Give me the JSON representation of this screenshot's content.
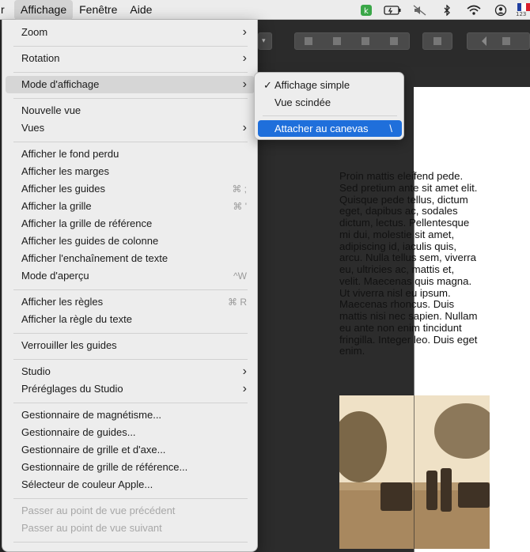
{
  "menubar": {
    "partial": "r",
    "items": [
      "Affichage",
      "Fenêtre",
      "Aide"
    ],
    "active": "Affichage",
    "status_icons": [
      "app-k-icon",
      "battery-plug-icon",
      "mute-icon",
      "bluetooth-icon",
      "wifi-icon",
      "user-icon"
    ],
    "keyboard_layout": "123"
  },
  "menu": {
    "items": [
      {
        "label": "Zoom",
        "submenu": true
      },
      {
        "label": "Rotation",
        "submenu": true
      },
      {
        "label": "Mode d'affichage",
        "submenu": true,
        "highlighted": true
      },
      {
        "label": "Nouvelle vue"
      },
      {
        "label": "Vues",
        "submenu": true
      },
      {
        "label": "Afficher le fond perdu"
      },
      {
        "label": "Afficher les marges"
      },
      {
        "label": "Afficher les guides",
        "shortcut": "⌘ ;"
      },
      {
        "label": "Afficher la grille",
        "shortcut": "⌘ '"
      },
      {
        "label": "Afficher la grille de référence"
      },
      {
        "label": "Afficher les guides de colonne"
      },
      {
        "label": "Afficher l'enchaînement de texte"
      },
      {
        "label": "Mode d'aperçu",
        "shortcut": "^W"
      },
      {
        "label": "Afficher les règles",
        "shortcut": "⌘ R"
      },
      {
        "label": "Afficher la règle du texte"
      },
      {
        "label": "Verrouiller les guides"
      },
      {
        "label": "Studio",
        "submenu": true
      },
      {
        "label": "Préréglages du Studio",
        "submenu": true
      },
      {
        "label": "Gestionnaire de magnétisme..."
      },
      {
        "label": "Gestionnaire de guides..."
      },
      {
        "label": "Gestionnaire de grille et d'axe..."
      },
      {
        "label": "Gestionnaire de grille de référence..."
      },
      {
        "label": "Sélecteur de couleur Apple..."
      },
      {
        "label": "Passer au point de vue précédent",
        "disabled": true
      },
      {
        "label": "Passer au point de vue suivant",
        "disabled": true
      }
    ]
  },
  "submenu": {
    "items": [
      {
        "label": "Affichage simple",
        "checked": true
      },
      {
        "label": "Vue scindée"
      },
      {
        "label": "Attacher au canevas",
        "selected": true,
        "shortcut": "\\"
      }
    ]
  },
  "document": {
    "text": "Proin mattis eleifend pede.\nSed pretium ante sit amet elit.\nQuisque pede tellus, dictum\neget, dapibus ac, sodales\ndictum, lectus. Pellentesque\nmi dui, molestie sit amet,\nadipiscing id, iaculis quis,\narcu. Nulla tellus sem, viverra\neu, ultricies ac, mattis et,\nvelit. Maecenas quis magna.\nUt viverra nisl eu ipsum.\nMaecenas rhoncus. Duis\nmattis nisi nec sapien. Nullam\neu ante non enim tincidunt\nfringilla. Integer leo. Duis eget\nenim."
  },
  "colors": {
    "selection": "#1f6fdb",
    "menu_bg": "#ededed",
    "canvas": "#2c2c2c"
  }
}
